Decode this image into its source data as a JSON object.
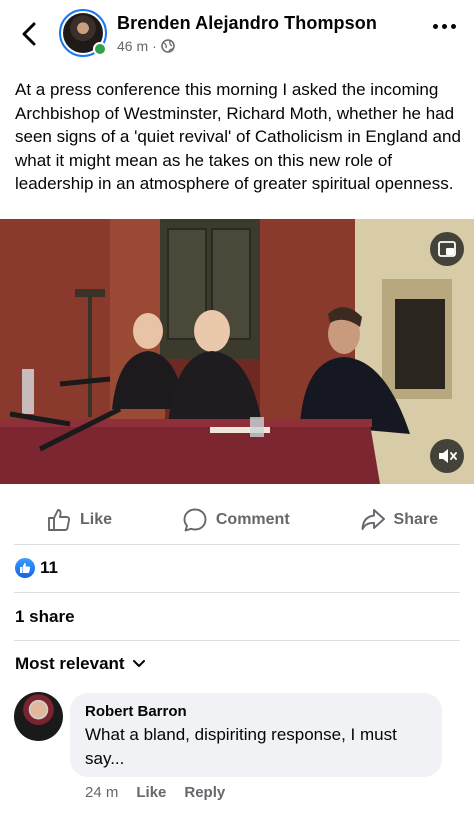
{
  "post": {
    "author": "Brenden Alejandro Thompson",
    "time": "46 m",
    "separator": "·",
    "text": "At a press conference this morning I asked the incoming Archbishop of Westminster, Richard Moth, whether he had seen signs of a 'quiet revival' of Catholicism in England and what it might mean as he takes on this new role of leadership in an atmosphere of greater spiritual openness."
  },
  "actions": {
    "like": "Like",
    "comment": "Comment",
    "share": "Share"
  },
  "reactions": {
    "count": "11"
  },
  "shares": "1 share",
  "sort_label": "Most relevant",
  "comment": {
    "author": "Robert Barron",
    "text": "What a bland, dispiriting response, I must say...",
    "time": "24 m",
    "like": "Like",
    "reply": "Reply"
  },
  "colors": {
    "accent": "#1877f2",
    "online": "#31a24c",
    "secondary_text": "#65676b",
    "bubble": "#f0f2f5"
  },
  "icons": [
    "back-icon",
    "globe-icon",
    "more-icon",
    "pip-icon",
    "mute-icon",
    "like-icon",
    "comment-icon",
    "share-icon",
    "like-reaction-icon",
    "chevron-down-icon"
  ]
}
